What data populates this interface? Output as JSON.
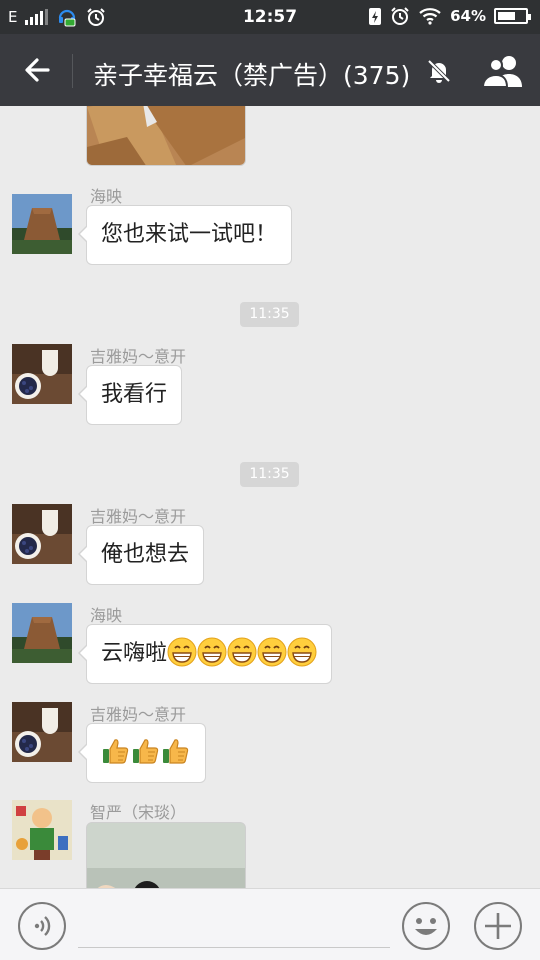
{
  "status_bar": {
    "network": "E",
    "time": "12:57",
    "battery_text": "64%",
    "battery_level": 0.64
  },
  "header": {
    "title": "亲子幸福云（禁广告）(375)",
    "back_icon": "back-arrow-icon",
    "mute_icon": "bell-off-icon",
    "members_icon": "group-members-icon"
  },
  "messages": [
    {
      "type": "image",
      "sender": "",
      "avatar": "self-image-top"
    },
    {
      "type": "text",
      "sender": "海映",
      "text": "您也来试一试吧！",
      "avatar": "landscape-rock-avatar"
    },
    {
      "type": "time",
      "text": "11:35"
    },
    {
      "type": "text",
      "sender": "吉雅妈～意开",
      "text": "我看行",
      "avatar": "blueberry-milk-avatar"
    },
    {
      "type": "time",
      "text": "11:35"
    },
    {
      "type": "text",
      "sender": "吉雅妈～意开",
      "text": "俺也想去",
      "avatar": "blueberry-milk-avatar"
    },
    {
      "type": "text",
      "sender": "海映",
      "text": "云嗨啦",
      "emoji": [
        "grin",
        "grin",
        "grin",
        "grin",
        "grin"
      ],
      "avatar": "landscape-rock-avatar"
    },
    {
      "type": "emoji",
      "sender": "吉雅妈～意开",
      "emoji": [
        "thumbs-up",
        "thumbs-up",
        "thumbs-up"
      ],
      "avatar": "blueberry-milk-avatar"
    },
    {
      "type": "image",
      "sender": "智严（宋琰）",
      "avatar": "cartoon-avatar"
    }
  ],
  "input_bar": {
    "voice_icon": "voice-icon",
    "emoji_icon": "smiley-icon",
    "plus_icon": "plus-icon"
  },
  "colors": {
    "header_bg": "#393a3f",
    "chat_bg": "#ebebeb",
    "bubble_bg": "#ffffff"
  }
}
